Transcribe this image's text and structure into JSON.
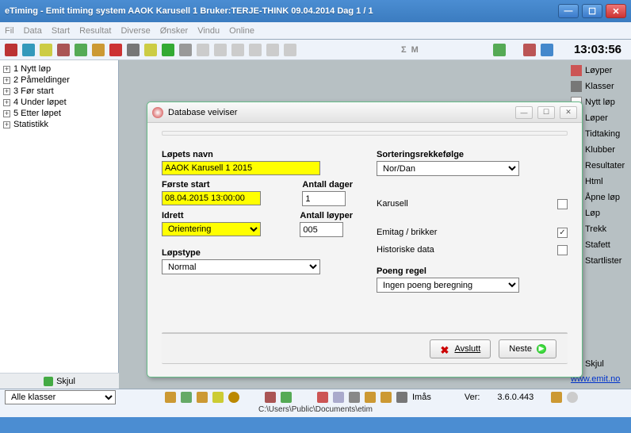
{
  "window": {
    "title": "eTiming - Emit timing system  AAOK Karusell 1  Bruker:TERJE-THINK  09.04.2014  Dag 1 / 1"
  },
  "menu": {
    "items": [
      "Fil",
      "Data",
      "Start",
      "Resultat",
      "Diverse",
      "Ønsker",
      "Vindu",
      "Online"
    ]
  },
  "toolbar": {
    "sigma": "Σ",
    "m": "M",
    "clock": "13:03:56"
  },
  "tree": {
    "nodes": [
      "1 Nytt løp",
      "2 Påmeldinger",
      "3 Før start",
      "4 Under løpet",
      "5 Etter løpet",
      "Statistikk"
    ],
    "skjul": "Skjul"
  },
  "right": {
    "items": [
      "Løyper",
      "Klasser",
      "Nytt løp",
      "Løper",
      "Tidtaking",
      "Klubber",
      "Resultater",
      "Html",
      "Åpne løp",
      "Løp",
      "Trekk",
      "Stafett",
      "Startlister"
    ],
    "skjul": "Skjul",
    "url": "www.emit.no"
  },
  "dialog": {
    "title": "Database veiviser",
    "lbl_name": "Løpets navn",
    "val_name": "AAOK Karusell 1 2015",
    "lbl_first": "Første start",
    "val_first": "08.04.2015 13:00:00",
    "lbl_days": "Antall dager",
    "val_days": "1",
    "lbl_sport": "Idrett",
    "val_sport": "Orientering",
    "lbl_courses": "Antall løyper",
    "val_courses": "005",
    "lbl_type": "Løpstype",
    "val_type": "Normal",
    "lbl_sort": "Sorteringsrekkefølge",
    "val_sort": "Nor/Dan",
    "lbl_karusell": "Karusell",
    "lbl_emitag": "Emitag / brikker",
    "lbl_hist": "Historiske data",
    "lbl_poeng": "Poeng regel",
    "val_poeng": "Ingen poeng beregning",
    "btn_avslutt": "Avslutt",
    "btn_neste": "Neste"
  },
  "status": {
    "classes": "Alle klasser",
    "imas": "Imås",
    "ver_label": "Ver:",
    "ver": "3.6.0.443",
    "path": "C:\\Users\\Public\\Documents\\etim"
  }
}
